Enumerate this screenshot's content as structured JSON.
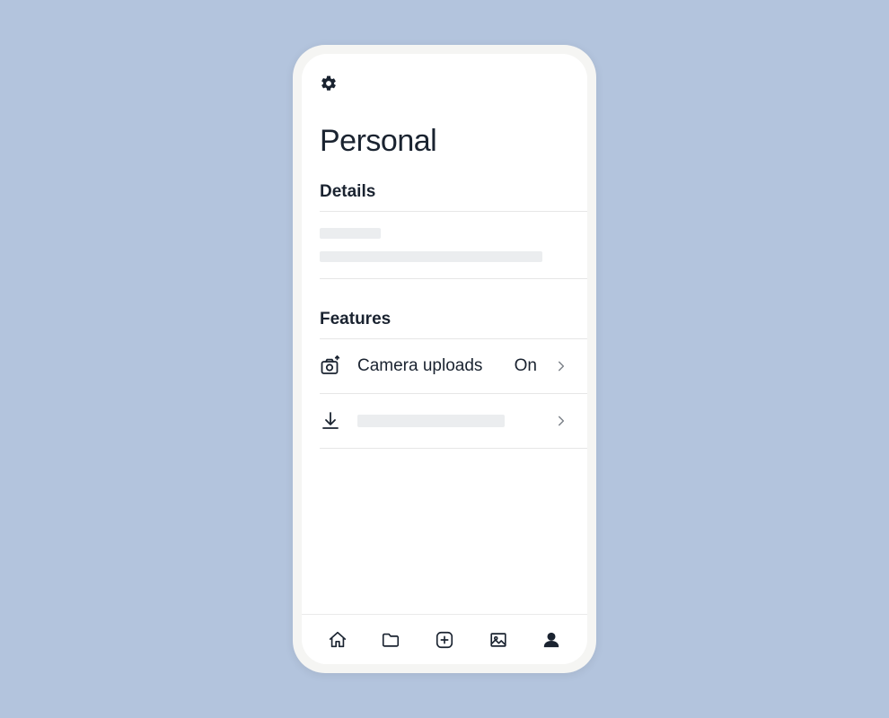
{
  "header": {
    "title": "Personal"
  },
  "sections": {
    "details": {
      "heading": "Details"
    },
    "features": {
      "heading": "Features",
      "rows": {
        "camera_uploads": {
          "label": "Camera uploads",
          "value": "On"
        }
      }
    }
  },
  "bottom_nav": {
    "active": "account"
  }
}
